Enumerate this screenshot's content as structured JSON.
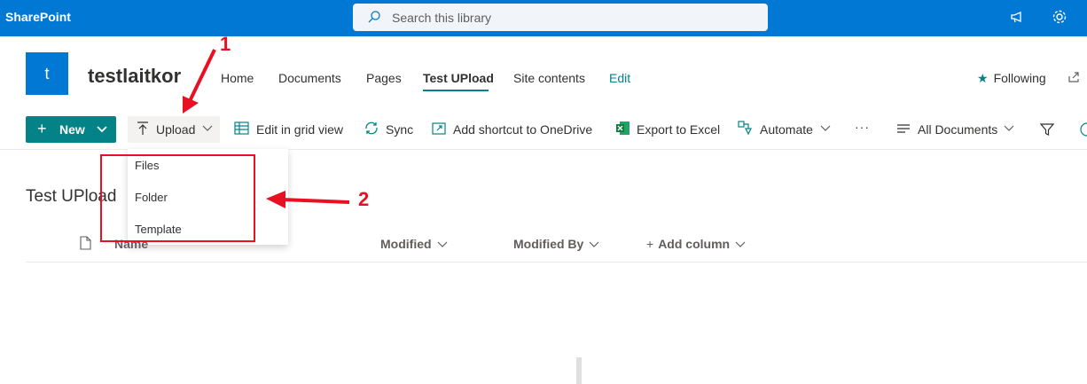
{
  "suitebar": {
    "brand": "SharePoint",
    "search_placeholder": "Search this library",
    "icons": [
      "megaphone-icon",
      "gear-icon"
    ]
  },
  "site": {
    "logo_letter": "t",
    "title": "testlaitkor",
    "nav": [
      "Home",
      "Documents",
      "Pages",
      "Test UPload",
      "Site contents",
      "Edit"
    ],
    "active_nav": "Test UPload",
    "following": "Following"
  },
  "commandbar": {
    "new": "New",
    "upload": "Upload",
    "edit_grid": "Edit in grid view",
    "sync": "Sync",
    "shortcut": "Add shortcut to OneDrive",
    "export": "Export to Excel",
    "automate": "Automate",
    "more": "···",
    "view": "All Documents"
  },
  "upload_menu": [
    "Files",
    "Folder",
    "Template"
  ],
  "library": {
    "title": "Test UPload",
    "columns": [
      "Name",
      "Modified",
      "Modified By",
      "Add column"
    ]
  },
  "annotations": [
    "1",
    "2"
  ],
  "colors": {
    "suitebar": "#0078d4",
    "accent": "#038387",
    "annotation": "#e81123"
  }
}
